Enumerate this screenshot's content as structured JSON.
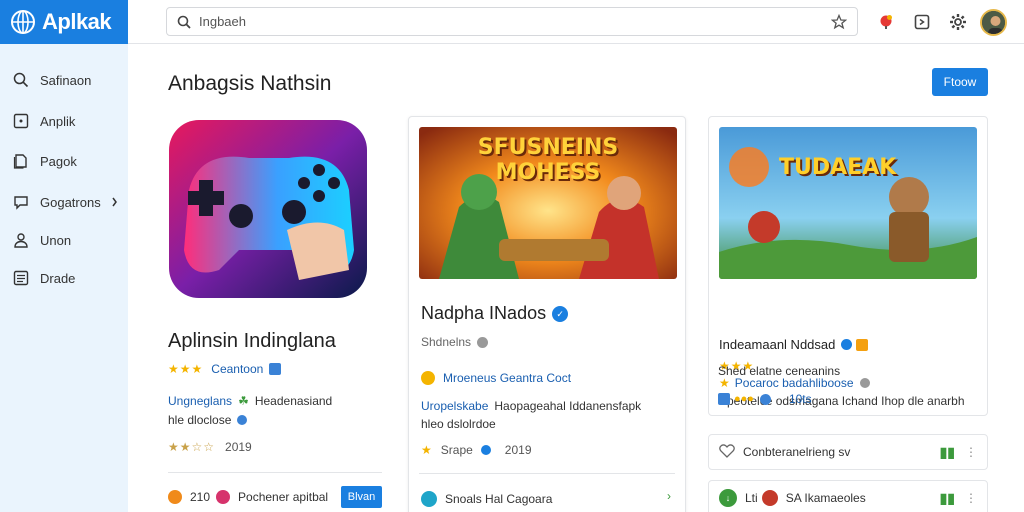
{
  "brand": {
    "name": "Aplkak"
  },
  "search": {
    "placeholder": "Ingbaeh"
  },
  "sidebar": {
    "items": [
      {
        "label": "Safinaon",
        "icon": "search-icon"
      },
      {
        "label": "Anplik",
        "icon": "app-icon"
      },
      {
        "label": "Pagok",
        "icon": "page-icon"
      },
      {
        "label": "Gogatrons",
        "icon": "chat-icon"
      },
      {
        "label": "Unon",
        "icon": "user-icon"
      },
      {
        "label": "Drade",
        "icon": "list-icon"
      }
    ]
  },
  "main": {
    "title": "Anbagsis Nathsin",
    "primary_button": "Ftoow"
  },
  "card1": {
    "title": "Aplinsin Indinglana",
    "category": "Ceantoon",
    "dev_line1": "Ungneglans",
    "dev_line1_rest": "Headenasiand",
    "dev_line2": "hle dloclose",
    "rating_num": "2019",
    "footer_num": "210",
    "footer_text": "Pochener apitbal",
    "footer_button": "Blvan"
  },
  "card2": {
    "banner_title_line1": "SFUSNEINS",
    "banner_title_line2": "MOHESS",
    "title": "Nadpha INados",
    "subtitle": "Shdnelns",
    "category": "Mroeneus Geantra Coct",
    "desc_blue": "Uropelskabe",
    "desc_rest": "Haopageahal Iddanensfapk",
    "desc_line2": "hleo dslolrdoe",
    "rating_label": "Srape",
    "rating_num": "2019",
    "footer_text": "Snoals Hal Cagoara"
  },
  "card3": {
    "banner_title": "TUDAEAK",
    "title": "Indeamaanl Nddsad",
    "category": "Pocaroc badahliboose",
    "desc_line1": "Speotelce odsmagana Ichand Ihop dle anarbh",
    "desc_line2": "Shed elatne ceneanins",
    "count": "10ts"
  },
  "mini_rows": [
    {
      "label": "Conbteranelrieng sv"
    },
    {
      "label": "SA Ikamaeoles",
      "prefix": "Lti"
    }
  ],
  "colors": {
    "accent": "#1a7fe0",
    "sidebar_bg": "#eaf4fd",
    "star": "#f4b400",
    "link": "#1a5fb0"
  }
}
